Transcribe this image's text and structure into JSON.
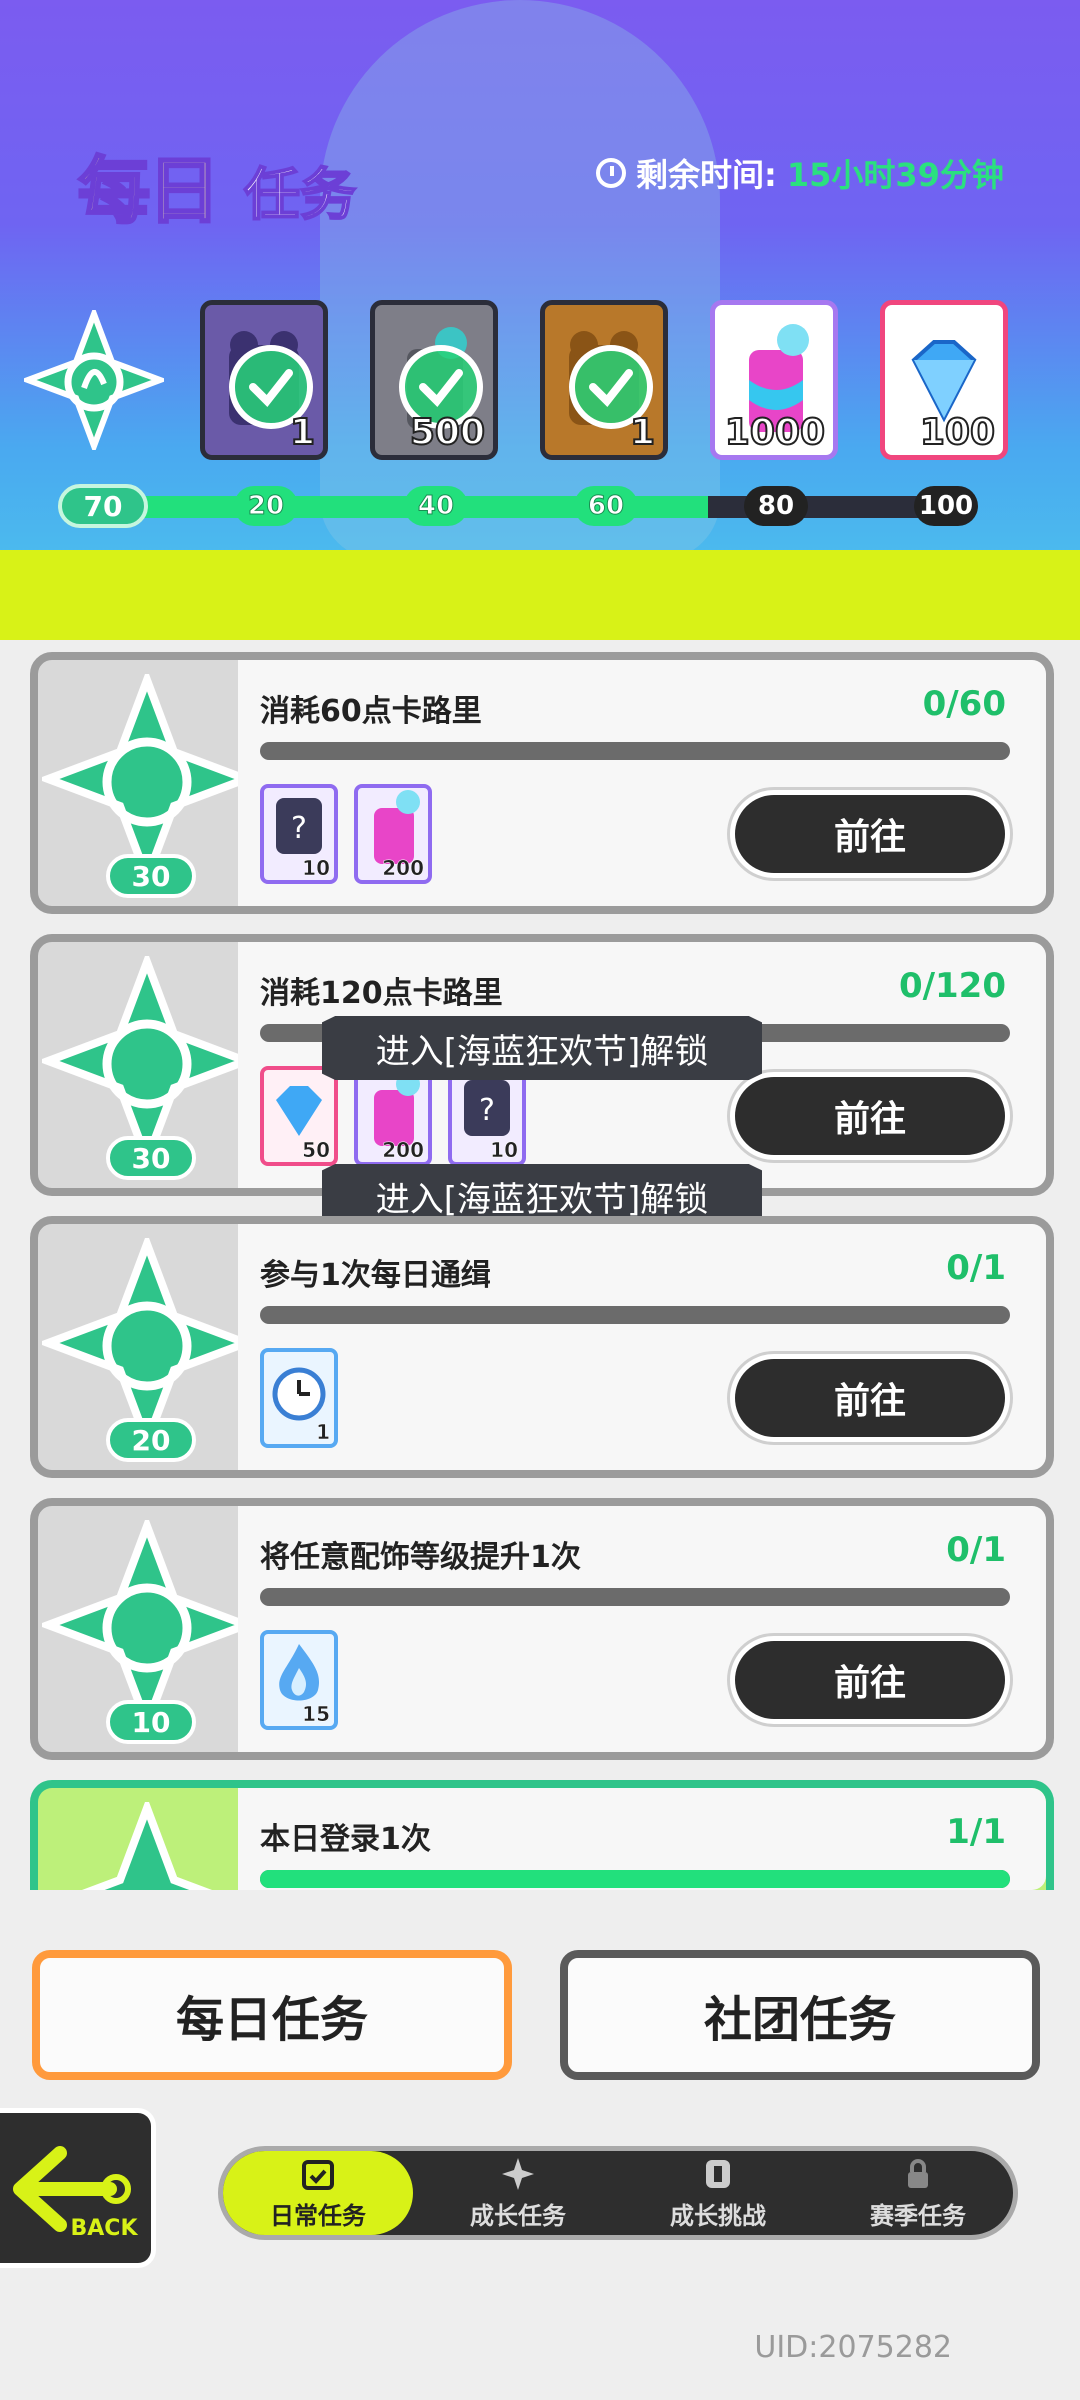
{
  "header": {
    "title_daily": "每日",
    "title_task": "任务",
    "timer_label": "剩余时间:",
    "timer_value": "15小时39分钟"
  },
  "milestones": {
    "current_points": "70",
    "rewards": [
      {
        "count": "1",
        "claimed": true
      },
      {
        "count": "500",
        "claimed": true
      },
      {
        "count": "1",
        "claimed": true
      },
      {
        "count": "1000",
        "claimed": false
      },
      {
        "count": "100",
        "claimed": false
      }
    ],
    "nodes": [
      "20",
      "40",
      "60",
      "80",
      "100"
    ],
    "progress": 0.7
  },
  "tasks": [
    {
      "name": "消耗60点卡路里",
      "progress": "0/60",
      "points": "30",
      "go": "前往",
      "items": [
        {
          "count": "10"
        },
        {
          "count": "200"
        }
      ]
    },
    {
      "name": "消耗120点卡路里",
      "progress": "0/120",
      "points": "30",
      "go": "前往",
      "items": [
        {
          "count": "50"
        },
        {
          "count": "200"
        },
        {
          "count": "10"
        }
      ]
    },
    {
      "name": "参与1次每日通缉",
      "progress": "0/1",
      "points": "20",
      "go": "前往",
      "items": [
        {
          "count": "1"
        }
      ]
    },
    {
      "name": "将任意配饰等级提升1次",
      "progress": "0/1",
      "points": "10",
      "go": "前往",
      "items": [
        {
          "count": "15"
        }
      ]
    },
    {
      "name": "本日登录1次",
      "progress": "1/1"
    }
  ],
  "lock_notice": "进入[海蓝狂欢节]解锁",
  "tabs": {
    "daily": "每日任务",
    "club": "社团任务"
  },
  "back_label": "BACK",
  "nav": [
    {
      "label": "日常任务",
      "icon": "calendar-check-icon"
    },
    {
      "label": "成长任务",
      "icon": "growth-icon"
    },
    {
      "label": "成长挑战",
      "icon": "challenge-icon"
    },
    {
      "label": "赛季任务",
      "icon": "lock-icon"
    }
  ],
  "uid": "UID:2075282",
  "colors": {
    "accent_green": "#22e07c",
    "lime": "#d8f217",
    "orange": "#ff9a3c"
  }
}
